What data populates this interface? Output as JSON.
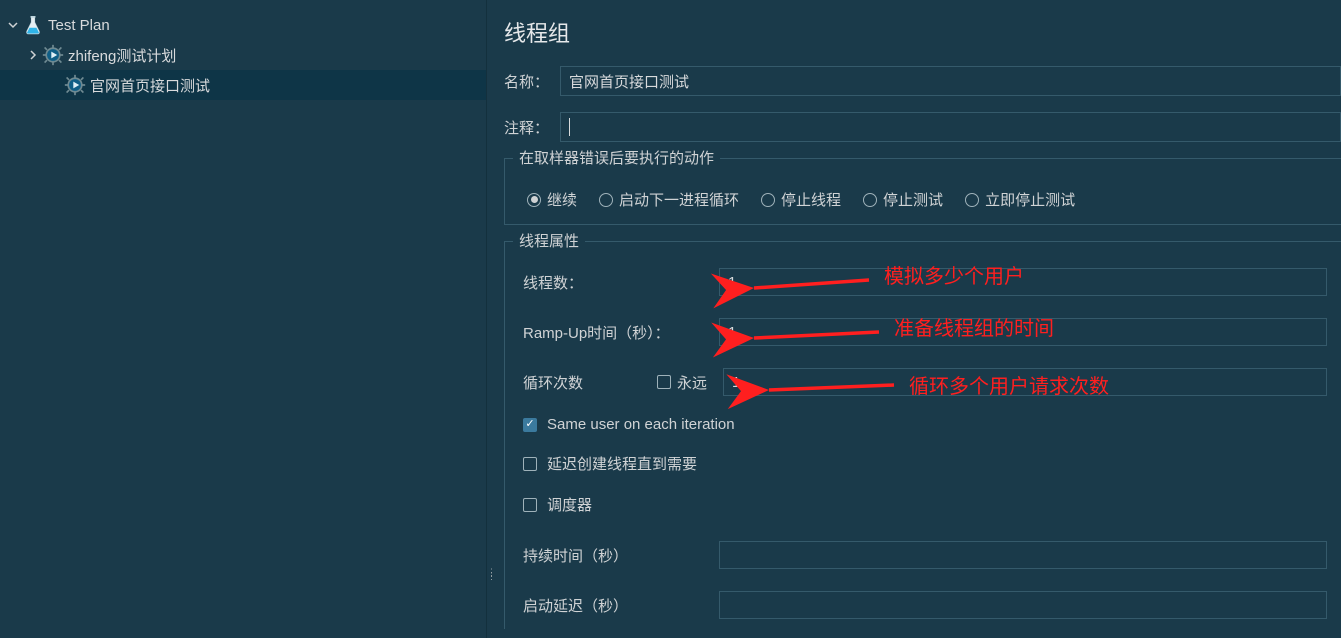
{
  "colors": {
    "accent": "#3b7a9e",
    "bg": "#1a3a4a",
    "border": "#355a6b",
    "annotation": "#ff1f1f"
  },
  "tree": {
    "items": [
      {
        "label": "Test Plan",
        "icon": "flask-icon",
        "expanded": true,
        "level": 0,
        "selected": false
      },
      {
        "label": "zhifeng测试计划",
        "icon": "gear-play-icon",
        "expanded": true,
        "level": 1,
        "selected": false
      },
      {
        "label": "官网首页接口测试",
        "icon": "gear-play-icon",
        "expanded": false,
        "level": 2,
        "selected": true
      }
    ]
  },
  "panel": {
    "title": "线程组",
    "name_label": "名称：",
    "name_value": "官网首页接口测试",
    "comment_label": "注释：",
    "comment_value": "",
    "error_group_legend": "在取样器错误后要执行的动作",
    "error_options": [
      {
        "label": "继续",
        "checked": true
      },
      {
        "label": "启动下一进程循环",
        "checked": false
      },
      {
        "label": "停止线程",
        "checked": false
      },
      {
        "label": "停止测试",
        "checked": false
      },
      {
        "label": "立即停止测试",
        "checked": false
      }
    ],
    "thread_props_legend": "线程属性",
    "threads_label": "线程数：",
    "threads_value": "1",
    "rampup_label": "Ramp-Up时间（秒）：",
    "rampup_value": "1",
    "loop_label": "循环次数",
    "loop_value": "1",
    "loop_forever_label": "永远",
    "loop_forever_checked": false,
    "same_user_label": "Same user on each iteration",
    "same_user_checked": true,
    "delay_create_label": "延迟创建线程直到需要",
    "delay_create_checked": false,
    "scheduler_label": "调度器",
    "scheduler_checked": false,
    "duration_label": "持续时间（秒）",
    "duration_value": "",
    "startup_delay_label": "启动延迟（秒）",
    "startup_delay_value": ""
  },
  "annotations": {
    "threads": "模拟多少个用户",
    "rampup": "准备线程组的时间",
    "loop": "循环多个用户请求次数"
  }
}
